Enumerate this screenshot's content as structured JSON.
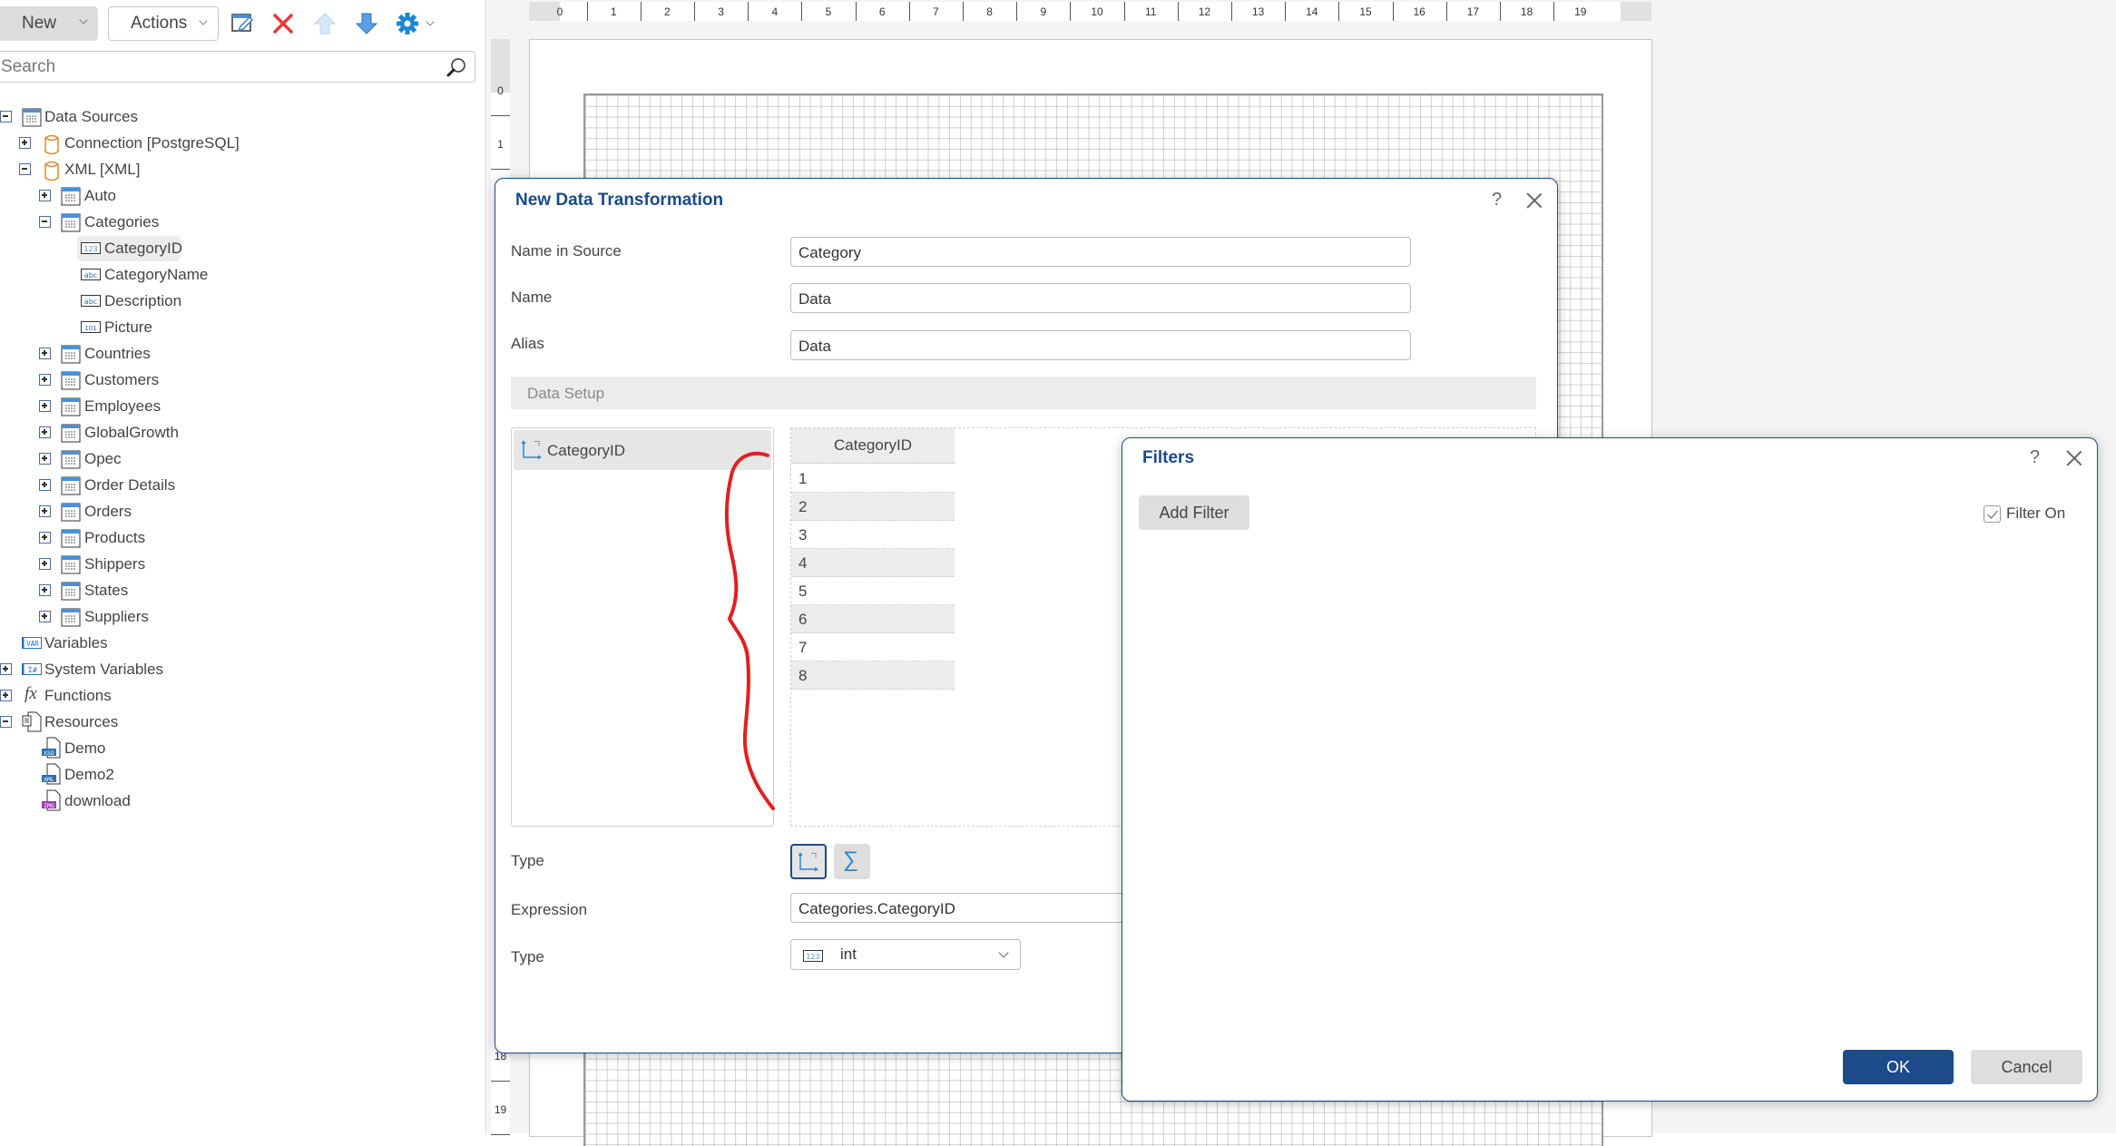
{
  "toolbar": {
    "new_label": "New",
    "actions_label": "Actions",
    "icons": [
      "edit-icon",
      "delete-icon",
      "move-up-icon",
      "move-down-icon",
      "settings-icon"
    ]
  },
  "search": {
    "placeholder": "Search",
    "value": ""
  },
  "tree": {
    "data_sources": "Data Sources",
    "connection": "Connection [PostgreSQL]",
    "xml": "XML [XML]",
    "tables": {
      "auto": "Auto",
      "categories": "Categories",
      "countries": "Countries",
      "customers": "Customers",
      "employees": "Employees",
      "globalgrowth": "GlobalGrowth",
      "opec": "Opec",
      "order_details": "Order Details",
      "orders": "Orders",
      "products": "Products",
      "shippers": "Shippers",
      "states": "States",
      "suppliers": "Suppliers"
    },
    "columns": {
      "categoryid": "CategoryID",
      "categoryname": "CategoryName",
      "description": "Description",
      "picture": "Picture"
    },
    "column_type_badges": {
      "int": "123",
      "string": "abc"
    },
    "variables": "Variables",
    "variables_badge": "VAR",
    "system_variables": "System Variables",
    "functions": "Functions",
    "functions_badge": "fx",
    "resources": "Resources",
    "resource_items": {
      "demo": "Demo",
      "demo_badge": "XSD",
      "demo2": "Demo2",
      "demo2_badge": "XML",
      "download": "download",
      "download_badge": "IMG"
    }
  },
  "ruler": {
    "horizontal": [
      "0",
      "1",
      "2",
      "3",
      "4",
      "5",
      "6",
      "7",
      "8",
      "9",
      "10",
      "11",
      "12",
      "13",
      "14",
      "15",
      "16",
      "17",
      "18",
      "19"
    ],
    "vertical_top": [
      "0",
      "1"
    ],
    "vertical_bottom": [
      "18",
      "19"
    ]
  },
  "transformation_dialog": {
    "title": "New Data Transformation",
    "help": "?",
    "name_in_source_label": "Name in Source",
    "name_in_source_value": "Category",
    "name_label": "Name",
    "name_value": "Data",
    "alias_label": "Alias",
    "alias_value": "Data",
    "section_label": "Data Setup",
    "columns": [
      "CategoryID"
    ],
    "preview_header": "CategoryID",
    "preview_rows": [
      "1",
      "2",
      "3",
      "4",
      "5",
      "6",
      "7",
      "8"
    ],
    "type_label": "Type",
    "type_options": [
      "dimension",
      "measure"
    ],
    "type_selected": "dimension",
    "expression_label": "Expression",
    "expression_value": "Categories.CategoryID",
    "data_type_label": "Type",
    "data_type_value": "int",
    "data_type_badge": "123"
  },
  "filters_dialog": {
    "title": "Filters",
    "help": "?",
    "add_filter_label": "Add Filter",
    "filter_on_label": "Filter On",
    "filter_on_checked": true,
    "ok_label": "OK",
    "cancel_label": "Cancel"
  },
  "colors": {
    "accent": "#1c4a8a",
    "annotation": "#e02020",
    "delete": "#e53935",
    "table_icon": "#4a90d9",
    "datasource_icon": "#e08a2e"
  }
}
